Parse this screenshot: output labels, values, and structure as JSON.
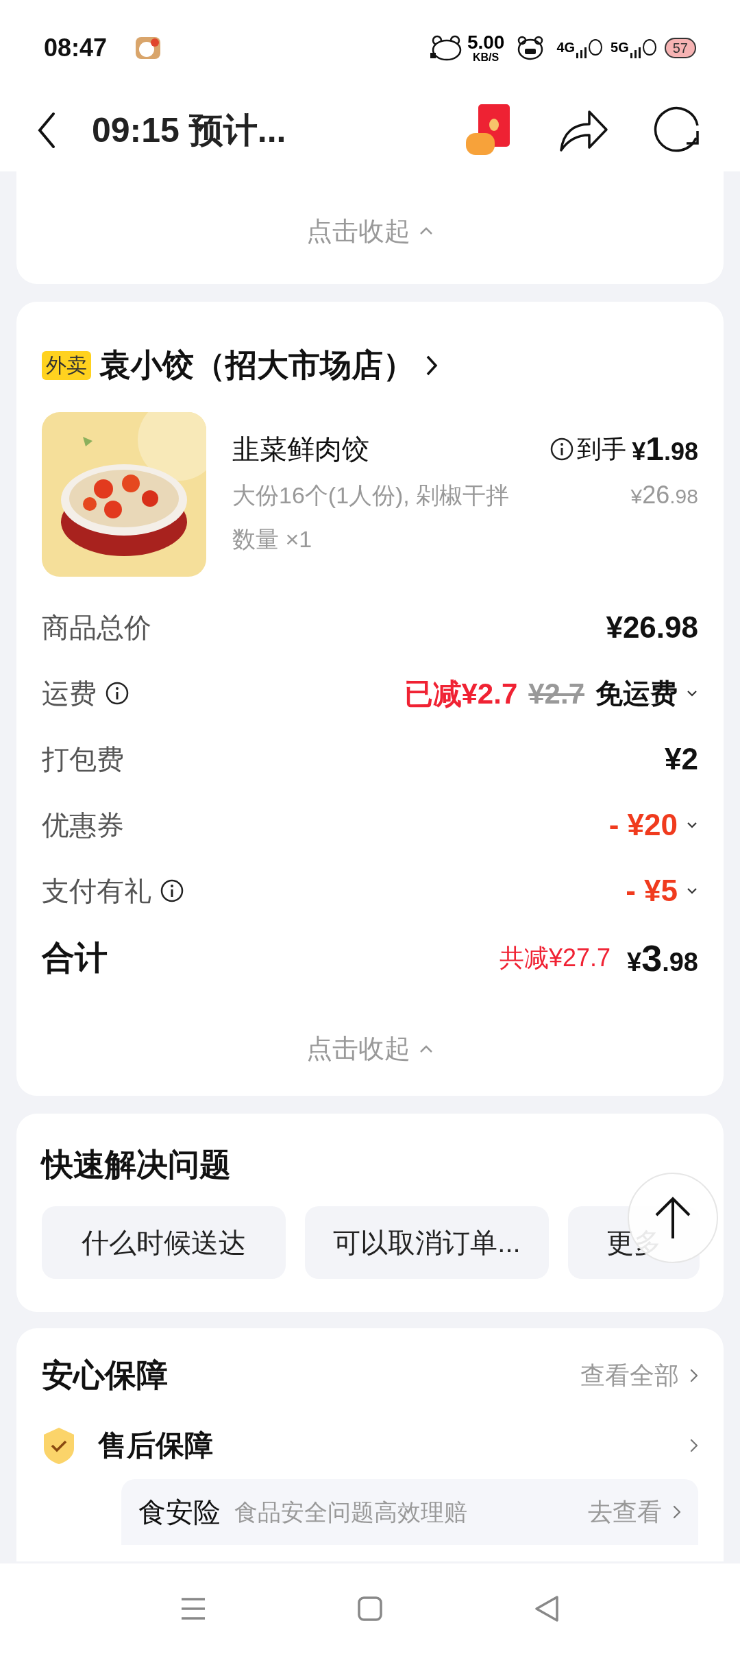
{
  "status_bar": {
    "time": "08:47",
    "speed": "5.00",
    "speed_unit": "KB/S",
    "network_1": "4G",
    "network_2": "5G",
    "battery": "57"
  },
  "header": {
    "title": "09:15 预计..."
  },
  "collapsed_card": {
    "toggle": "点击收起"
  },
  "order": {
    "tag": "外卖",
    "store": "袁小饺（招大市场店）",
    "item": {
      "kind": "picture",
      "name": "韭菜鲜肉饺",
      "spec": "大份16个(1人份), 剁椒干拌",
      "quantity": "数量 ×1",
      "final_label": "到手",
      "final_price": "¥1.98",
      "original_price": "¥26.98"
    },
    "fees": [
      {
        "label": "商品总价",
        "info": false,
        "kind": "plain",
        "value": "¥26.98",
        "expandable": false
      },
      {
        "label": "运费",
        "info": true,
        "kind": "free-shipping",
        "discount": "已减¥2.7",
        "original": "¥2.7",
        "value": "免运费",
        "expandable": true
      },
      {
        "label": "打包费",
        "info": false,
        "kind": "plain",
        "value": "¥2",
        "expandable": false
      },
      {
        "label": "优惠券",
        "info": false,
        "kind": "deduction",
        "value": "- ¥20",
        "expandable": true
      },
      {
        "label": "支付有礼",
        "info": true,
        "kind": "deduction",
        "value": "- ¥5",
        "expandable": true
      }
    ],
    "total": {
      "label": "合计",
      "saved": "共减¥27.7",
      "value": "¥3.98"
    },
    "toggle": "点击收起"
  },
  "quick_help": {
    "title": "快速解决问题",
    "chips": [
      "什么时候送达",
      "可以取消订单...",
      "更多"
    ]
  },
  "guarantee": {
    "title": "安心保障",
    "view_all": "查看全部",
    "section": "售后保障",
    "insurance": {
      "name": "食安险",
      "desc": "食品安全问题高效理赔",
      "action": "去查看"
    }
  }
}
